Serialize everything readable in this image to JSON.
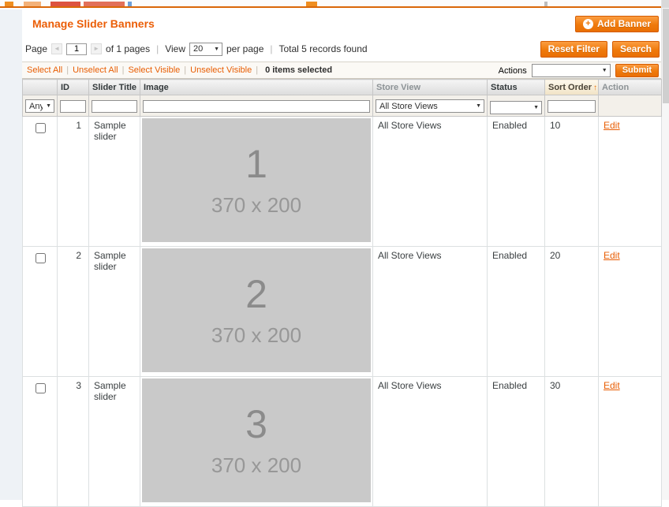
{
  "icons": {
    "dropdown_arrow": "▼",
    "sort_ascending": "↑",
    "plus": "+",
    "pager_prev": "◄",
    "pager_next": "►",
    "separator": "|"
  },
  "colors": {
    "accent_orange": "#eb5e07",
    "button_orange": "#ef7a0c",
    "link_orange": "#e85d03",
    "placeholder_gray": "#c9c9c9"
  },
  "page_header": {
    "title": "Manage Slider Banners",
    "add_button_label": "Add Banner"
  },
  "pager": {
    "page_label": "Page",
    "page_value": "1",
    "pages_total_text": "of 1 pages",
    "view_label": "View",
    "view_value": "20",
    "per_page_label": "per page",
    "total_records_text": "Total 5 records found",
    "reset_filter_label": "Reset Filter",
    "search_label": "Search"
  },
  "massaction": {
    "select_all": "Select All",
    "unselect_all": "Unselect All",
    "select_visible": "Select Visible",
    "unselect_visible": "Unselect Visible",
    "items_selected_text": "0 items selected",
    "actions_label": "Actions",
    "submit_label": "Submit"
  },
  "grid": {
    "columns": {
      "id": "ID",
      "slider_title": "Slider Title",
      "image": "Image",
      "store_view": "Store View",
      "status": "Status",
      "sort_order": "Sort Order",
      "action": "Action"
    },
    "filters": {
      "massaction_any": "Any",
      "store_view_selected": "All Store Views"
    },
    "rows": [
      {
        "id": "1",
        "slider_title": "Sample slider",
        "image_number": "1",
        "image_size": "370 x 200",
        "store_view": "All Store Views",
        "status": "Enabled",
        "sort_order": "10",
        "action": "Edit"
      },
      {
        "id": "2",
        "slider_title": "Sample slider",
        "image_number": "2",
        "image_size": "370 x 200",
        "store_view": "All Store Views",
        "status": "Enabled",
        "sort_order": "20",
        "action": "Edit"
      },
      {
        "id": "3",
        "slider_title": "Sample slider",
        "image_number": "3",
        "image_size": "370 x 200",
        "store_view": "All Store Views",
        "status": "Enabled",
        "sort_order": "30",
        "action": "Edit"
      }
    ]
  }
}
